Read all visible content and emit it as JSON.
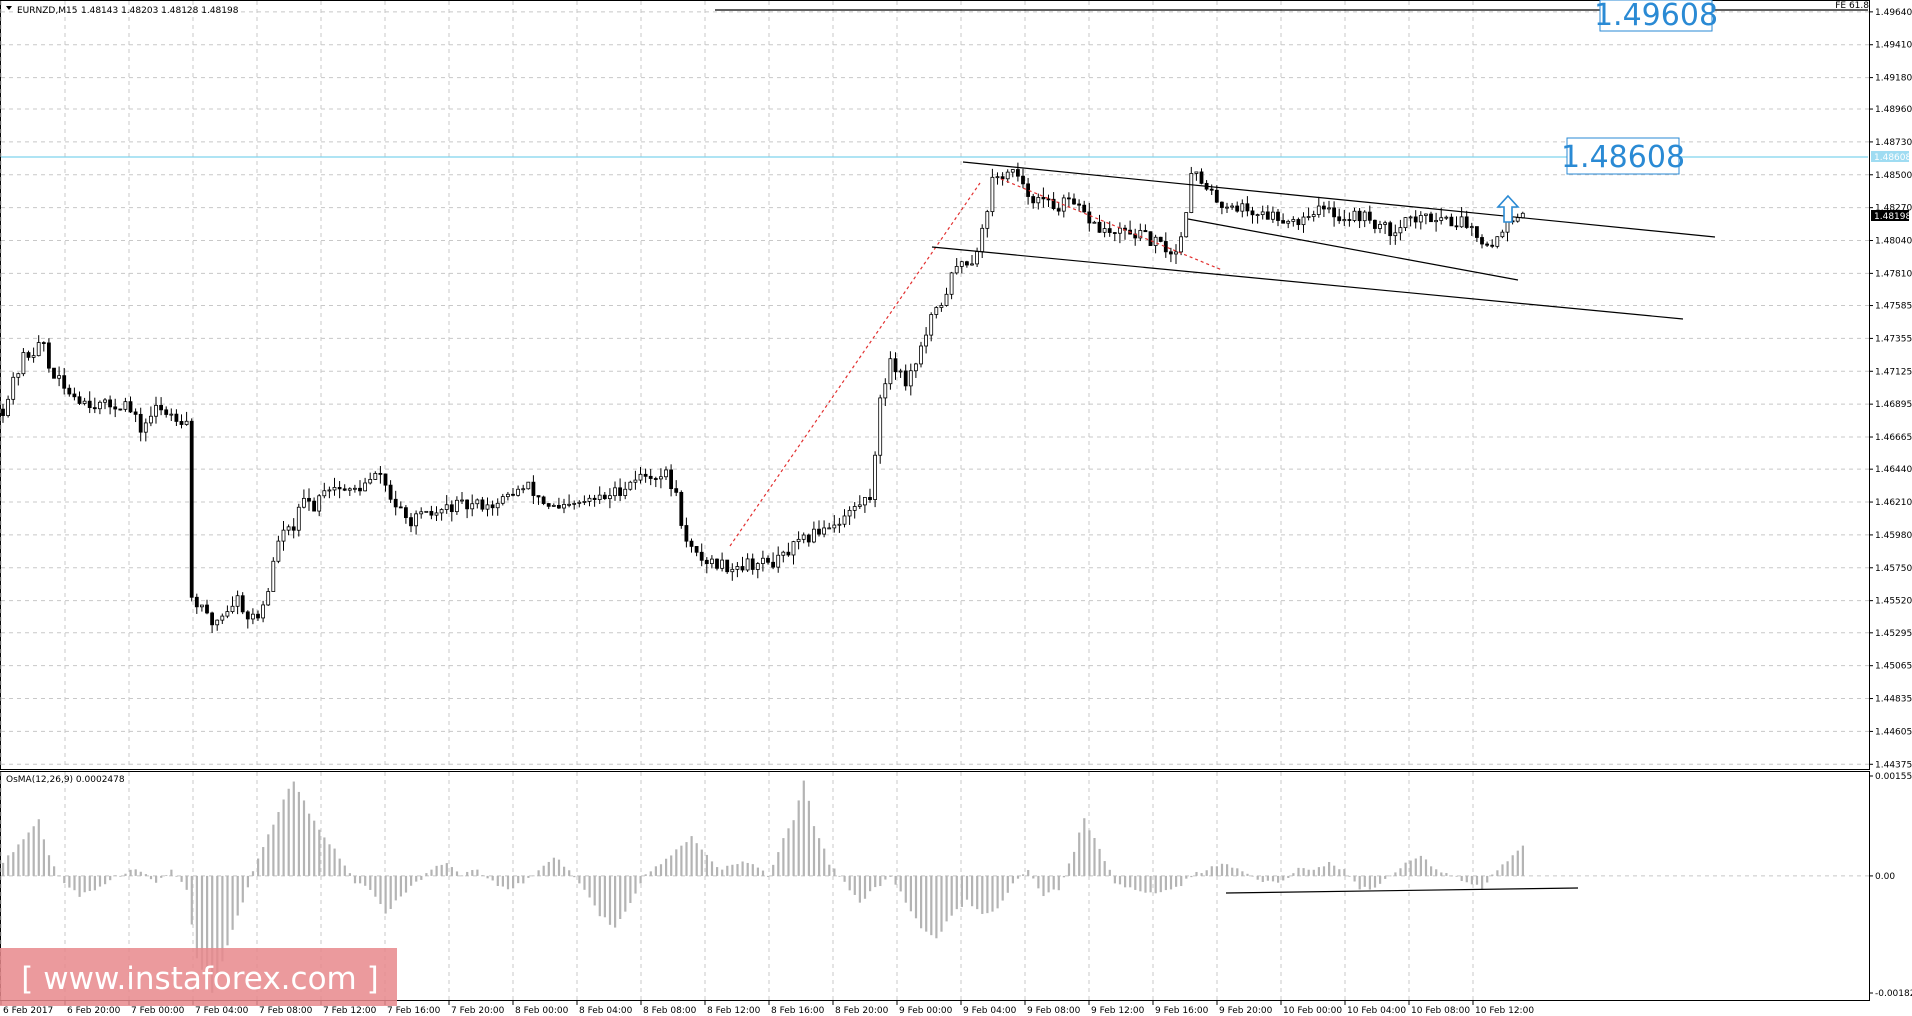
{
  "header": {
    "symbol": "EURNZD,M15",
    "ohlc": "1.48143 1.48203 1.48128 1.48198",
    "indicator": "OsMA(12,26,9) 0.0002478"
  },
  "fib_label": "FE 61.8",
  "levels": {
    "upper_target": "1.49608",
    "target": "1.48608",
    "current_price": "1.48198",
    "target_tag": "1.48608"
  },
  "colors": {
    "level_line": "#7fd3ee",
    "level_text": "#2a8ad4",
    "current_tag_bg": "#000000",
    "target_tag_bg": "#9fdcf2",
    "candle": "#000000",
    "histogram": "#b4b4b4",
    "dotted_line": "#e23030",
    "watermark_bg": "#e8888c",
    "arrow": "#2a8ad4"
  },
  "watermark": "[ www.instaforex.com ]",
  "chart_data": [
    {
      "type": "candlestick",
      "symbol": "EURNZD",
      "timeframe": "M15",
      "ylim": [
        1.4437,
        1.4966
      ],
      "y_ticks": [
        "1.49640",
        "1.49410",
        "1.49180",
        "1.48960",
        "1.48730",
        "1.48500",
        "1.48270",
        "1.48040",
        "1.47810",
        "1.47585",
        "1.47355",
        "1.47125",
        "1.46895",
        "1.46665",
        "1.46440",
        "1.46210",
        "1.45980",
        "1.45750",
        "1.45520",
        "1.45295",
        "1.45065",
        "1.44835",
        "1.44605",
        "1.44375"
      ],
      "x_ticks": [
        "6 Feb 2017",
        "6 Feb 20:00",
        "7 Feb 00:00",
        "7 Feb 04:00",
        "7 Feb 08:00",
        "7 Feb 12:00",
        "7 Feb 16:00",
        "7 Feb 20:00",
        "8 Feb 00:00",
        "8 Feb 04:00",
        "8 Feb 08:00",
        "8 Feb 12:00",
        "8 Feb 16:00",
        "8 Feb 20:00",
        "9 Feb 00:00",
        "9 Feb 04:00",
        "9 Feb 08:00",
        "9 Feb 12:00",
        "9 Feb 16:00",
        "9 Feb 20:00",
        "10 Feb 00:00",
        "10 Feb 04:00",
        "10 Feb 08:00",
        "10 Feb 12:00"
      ],
      "close_path": [
        [
          0,
          1.4686
        ],
        [
          4,
          1.4722
        ],
        [
          8,
          1.4732
        ],
        [
          9,
          1.4715
        ],
        [
          12,
          1.47
        ],
        [
          16,
          1.4692
        ],
        [
          20,
          1.4688
        ],
        [
          24,
          1.469
        ],
        [
          27,
          1.4672
        ],
        [
          30,
          1.4686
        ],
        [
          33,
          1.4683
        ],
        [
          36,
          1.4678
        ],
        [
          37,
          1.4555
        ],
        [
          39,
          1.4545
        ],
        [
          41,
          1.4536
        ],
        [
          44,
          1.4546
        ],
        [
          46,
          1.4554
        ],
        [
          48,
          1.4541
        ],
        [
          50,
          1.454
        ],
        [
          52,
          1.456
        ],
        [
          54,
          1.4595
        ],
        [
          57,
          1.4604
        ],
        [
          59,
          1.4622
        ],
        [
          61,
          1.4618
        ],
        [
          63,
          1.4632
        ],
        [
          65,
          1.4632
        ],
        [
          68,
          1.4628
        ],
        [
          71,
          1.4633
        ],
        [
          74,
          1.4641
        ],
        [
          76,
          1.4624
        ],
        [
          79,
          1.4608
        ],
        [
          82,
          1.461
        ],
        [
          85,
          1.4613
        ],
        [
          88,
          1.4618
        ],
        [
          91,
          1.4618
        ],
        [
          94,
          1.462
        ],
        [
          97,
          1.4619
        ],
        [
          100,
          1.4628
        ],
        [
          103,
          1.4631
        ],
        [
          106,
          1.4621
        ],
        [
          109,
          1.4615
        ],
        [
          112,
          1.4618
        ],
        [
          115,
          1.4622
        ],
        [
          118,
          1.4624
        ],
        [
          121,
          1.463
        ],
        [
          124,
          1.4638
        ],
        [
          127,
          1.464
        ],
        [
          130,
          1.464
        ],
        [
          132,
          1.4625
        ],
        [
          134,
          1.4592
        ],
        [
          136,
          1.4583
        ],
        [
          138,
          1.458
        ],
        [
          140,
          1.4578
        ],
        [
          143,
          1.4576
        ],
        [
          146,
          1.4578
        ],
        [
          149,
          1.4578
        ],
        [
          152,
          1.458
        ],
        [
          155,
          1.4589
        ],
        [
          158,
          1.4596
        ],
        [
          161,
          1.4604
        ],
        [
          164,
          1.4608
        ],
        [
          167,
          1.4617
        ],
        [
          170,
          1.4625
        ],
        [
          172,
          1.469
        ],
        [
          174,
          1.4722
        ],
        [
          177,
          1.4705
        ],
        [
          180,
          1.4728
        ],
        [
          182,
          1.4748
        ],
        [
          184,
          1.476
        ],
        [
          186,
          1.4778
        ],
        [
          188,
          1.479
        ],
        [
          190,
          1.479
        ],
        [
          192,
          1.481
        ],
        [
          194,
          1.4845
        ],
        [
          196,
          1.485
        ],
        [
          198,
          1.4852
        ],
        [
          200,
          1.484
        ],
        [
          203,
          1.4832
        ],
        [
          206,
          1.4828
        ],
        [
          209,
          1.483
        ],
        [
          212,
          1.4822
        ],
        [
          215,
          1.4812
        ],
        [
          218,
          1.4808
        ],
        [
          221,
          1.481
        ],
        [
          224,
          1.4806
        ],
        [
          227,
          1.48
        ],
        [
          230,
          1.4795
        ],
        [
          232,
          1.4825
        ],
        [
          233,
          1.4855
        ],
        [
          236,
          1.4838
        ],
        [
          239,
          1.483
        ],
        [
          242,
          1.4828
        ],
        [
          245,
          1.4824
        ],
        [
          248,
          1.4822
        ],
        [
          251,
          1.482
        ],
        [
          254,
          1.4818
        ],
        [
          257,
          1.4826
        ],
        [
          260,
          1.4824
        ],
        [
          263,
          1.482
        ],
        [
          266,
          1.4822
        ],
        [
          269,
          1.4816
        ],
        [
          272,
          1.481
        ],
        [
          275,
          1.482
        ],
        [
          278,
          1.4818
        ],
        [
          281,
          1.4822
        ],
        [
          284,
          1.4818
        ],
        [
          287,
          1.4816
        ],
        [
          290,
          1.4806
        ],
        [
          292,
          1.48
        ],
        [
          294,
          1.4814
        ],
        [
          296,
          1.4816
        ],
        [
          298,
          1.482
        ]
      ],
      "annotations": {
        "horizontal_lines": [
          "1.49608",
          "1.48608"
        ],
        "trend_lines": "descending channel (flag) after rally; breakout arrow pointing up",
        "fibonacci": "FE 61.8"
      }
    },
    {
      "type": "histogram",
      "indicator": "OsMA(12,26,9)",
      "current_value": 0.0002478,
      "ylim": [
        -0.001827,
        0.001559
      ],
      "y_ticks": [
        "0.001559",
        "0.00",
        "-0.001827"
      ],
      "values_path": [
        [
          0,
          0.0002
        ],
        [
          4,
          0.0006
        ],
        [
          7,
          0.0009
        ],
        [
          9,
          0.0003
        ],
        [
          12,
          -0.0001
        ],
        [
          15,
          -0.0003
        ],
        [
          18,
          -0.0002
        ],
        [
          22,
          0.0
        ],
        [
          26,
          0.0001
        ],
        [
          30,
          -0.0001
        ],
        [
          33,
          0.0001
        ],
        [
          36,
          -0.0002
        ],
        [
          38,
          -0.0013
        ],
        [
          41,
          -0.0018
        ],
        [
          44,
          -0.0011
        ],
        [
          47,
          -0.0004
        ],
        [
          50,
          0.0003
        ],
        [
          53,
          0.0008
        ],
        [
          55,
          0.0012
        ],
        [
          57,
          0.0015
        ],
        [
          60,
          0.001
        ],
        [
          63,
          0.0006
        ],
        [
          66,
          0.0003
        ],
        [
          69,
          -0.0001
        ],
        [
          72,
          -0.0002
        ],
        [
          75,
          -0.0006
        ],
        [
          78,
          -0.0003
        ],
        [
          81,
          -0.0001
        ],
        [
          84,
          0.0001
        ],
        [
          87,
          0.0002
        ],
        [
          90,
          0.0
        ],
        [
          93,
          0.0001
        ],
        [
          96,
          -0.0001
        ],
        [
          99,
          -0.0002
        ],
        [
          102,
          -0.0001
        ],
        [
          105,
          0.0001
        ],
        [
          108,
          0.0003
        ],
        [
          111,
          0.0001
        ],
        [
          114,
          -0.0002
        ],
        [
          117,
          -0.0006
        ],
        [
          120,
          -0.0008
        ],
        [
          123,
          -0.0004
        ],
        [
          126,
          0.0
        ],
        [
          129,
          0.0002
        ],
        [
          132,
          0.0004
        ],
        [
          135,
          0.0006
        ],
        [
          138,
          0.0003
        ],
        [
          141,
          0.0001
        ],
        [
          144,
          0.0002
        ],
        [
          147,
          0.0002
        ],
        [
          150,
          0.0
        ],
        [
          153,
          0.0006
        ],
        [
          155,
          0.0009
        ],
        [
          157,
          0.0015
        ],
        [
          159,
          0.0008
        ],
        [
          162,
          0.0002
        ],
        [
          165,
          -0.0001
        ],
        [
          168,
          -0.0004
        ],
        [
          171,
          -0.0002
        ],
        [
          174,
          0.0
        ],
        [
          177,
          -0.0004
        ],
        [
          180,
          -0.0008
        ],
        [
          183,
          -0.001
        ],
        [
          186,
          -0.0006
        ],
        [
          189,
          -0.0004
        ],
        [
          192,
          -0.0006
        ],
        [
          195,
          -0.0005
        ],
        [
          198,
          -0.0001
        ],
        [
          201,
          0.0001
        ],
        [
          204,
          -0.0003
        ],
        [
          207,
          -0.0002
        ],
        [
          210,
          0.0004
        ],
        [
          212,
          0.0009
        ],
        [
          215,
          0.0004
        ],
        [
          218,
          -0.0001
        ],
        [
          222,
          -0.0002
        ],
        [
          226,
          -0.0003
        ],
        [
          230,
          -0.0002
        ],
        [
          233,
          0.0
        ],
        [
          236,
          0.0001
        ],
        [
          239,
          0.0002
        ],
        [
          242,
          0.0001
        ],
        [
          245,
          0.0
        ],
        [
          248,
          -0.0001
        ],
        [
          251,
          -0.0001
        ],
        [
          254,
          0.0001
        ],
        [
          257,
          0.0001
        ],
        [
          260,
          0.0002
        ],
        [
          263,
          0.0001
        ],
        [
          266,
          -0.0002
        ],
        [
          269,
          -0.0002
        ],
        [
          272,
          0.0
        ],
        [
          275,
          0.0002
        ],
        [
          278,
          0.0003
        ],
        [
          281,
          0.0001
        ],
        [
          284,
          0.0
        ],
        [
          287,
          -0.0001
        ],
        [
          290,
          -0.0002
        ],
        [
          293,
          0.0001
        ],
        [
          296,
          0.0003
        ],
        [
          298,
          0.0005
        ]
      ]
    }
  ]
}
